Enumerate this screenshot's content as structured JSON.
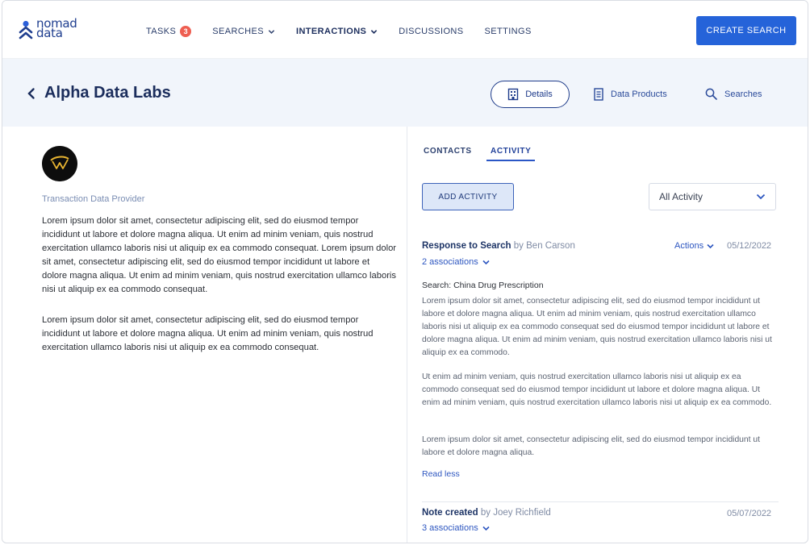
{
  "brand": {
    "name_line1": "nomad",
    "name_line2": "data"
  },
  "nav": {
    "tasks": "TASKS",
    "tasks_badge": "3",
    "searches": "SEARCHES",
    "interactions": "INTERACTIONS",
    "discussions": "DISCUSSIONS",
    "settings": "SETTINGS",
    "create_search": "CREATE SEARCH"
  },
  "header": {
    "title": "Alpha Data Labs",
    "tabs": {
      "details": "Details",
      "data_products": "Data Products",
      "searches": "Searches"
    }
  },
  "left": {
    "subtitle": "Transaction Data Provider",
    "paragraph1": "Lorem ipsum dolor sit amet, consectetur adipiscing elit, sed do eiusmod tempor incididunt ut labore et dolore magna aliqua. Ut enim ad minim veniam, quis nostrud exercitation ullamco laboris nisi ut aliquip ex ea commodo consequat. Lorem ipsum dolor sit amet, consectetur adipiscing elit, sed do eiusmod tempor incididunt ut labore et dolore magna aliqua. Ut enim ad minim veniam, quis nostrud exercitation ullamco laboris nisi ut aliquip ex ea commodo consequat.",
    "paragraph2": "Lorem ipsum dolor sit amet, consectetur adipiscing elit, sed do eiusmod tempor incididunt ut labore et dolore magna aliqua. Ut enim ad minim veniam, quis nostrud exercitation ullamco laboris nisi ut aliquip ex ea commodo consequat."
  },
  "right": {
    "tabs": {
      "contacts": "CONTACTS",
      "activity": "ACTIVITY"
    },
    "add_activity": "ADD ACTIVITY",
    "filter": "All Activity",
    "activities": [
      {
        "title": "Response to Search",
        "by": "by Ben Carson",
        "associations": "2 associations",
        "actions": "Actions",
        "date": "05/12/2022",
        "search_label": "Search: China Drug Prescription",
        "body1": "Lorem ipsum dolor sit amet, consectetur adipiscing elit, sed do eiusmod tempor incididunt ut labore et dolore magna aliqua. Ut enim ad minim veniam, quis nostrud exercitation ullamco laboris nisi ut aliquip ex ea commodo consequat sed do eiusmod tempor incididunt ut labore et dolore magna aliqua. Ut enim ad minim veniam, quis nostrud exercitation ullamco laboris nisi ut aliquip ex ea commodo.",
        "body2": "Ut enim ad minim veniam, quis nostrud exercitation ullamco laboris nisi ut aliquip ex ea commodo consequat  sed do eiusmod tempor incididunt ut labore et dolore magna aliqua. Ut enim ad minim veniam, quis nostrud exercitation ullamco laboris nisi ut aliquip ex ea commodo.",
        "body3": "Lorem ipsum dolor sit amet, consectetur adipiscing elit, sed do eiusmod tempor incididunt ut labore et dolore magna aliqua.",
        "read_less": "Read less"
      },
      {
        "title": "Note created",
        "by": "by Joey Richfield",
        "associations": "3 associations",
        "date": "05/07/2022"
      }
    ]
  }
}
